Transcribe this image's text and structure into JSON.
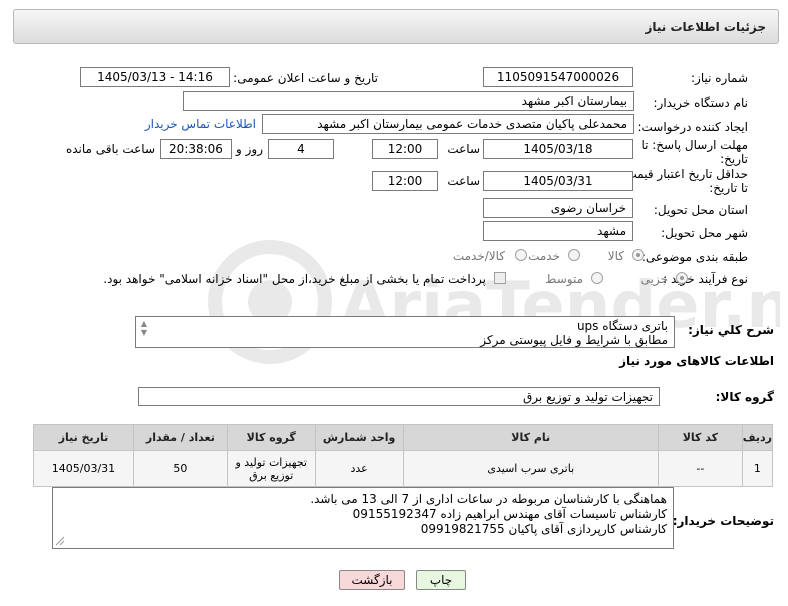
{
  "header": {
    "title": "جزئیات اطلاعات نیاز"
  },
  "fields": {
    "need_number_label": "شماره نیاز:",
    "need_number_value": "1105091547000026",
    "announce_label": "تاریخ و ساعت اعلان عمومی:",
    "announce_value": "1405/03/13 - 14:16",
    "buyer_org_label": "نام دستگاه خریدار:",
    "buyer_org_value": "بیمارستان اکبر مشهد",
    "requester_label": "ایجاد کننده درخواست:",
    "requester_value": "محمدعلی پاکیان متصدی خدمات عمومی بیمارستان اکبر مشهد",
    "contact_link": "اطلاعات تماس خریدار",
    "deadline_label_1": "مهلت ارسال پاسخ: تا",
    "deadline_label_2": "تاریخ:",
    "deadline_date": "1405/03/18",
    "time_label": "ساعت",
    "deadline_time": "12:00",
    "days_value": "4",
    "days_label": "روز و",
    "remaining_value": "20:38:06",
    "remaining_label": "ساعت باقی مانده",
    "price_valid_label_1": "حداقل تاریخ اعتبار قیمت:",
    "price_valid_label_2": "تا تاریخ:",
    "price_valid_date": "1405/03/31",
    "price_valid_time": "12:00",
    "province_label": "استان محل تحویل:",
    "province_value": "خراسان رضوی",
    "city_label": "شهر محل تحویل:",
    "city_value": "مشهد",
    "category_label": "طبقه بندی موضوعی:",
    "category_options": [
      "کالا",
      "خدمت",
      "کالا/خدمت"
    ],
    "process_label": "نوع فرآیند خرید :",
    "process_options": [
      "جزیی",
      "متوسط"
    ],
    "payment_note": "پرداخت تمام یا بخشی از مبلغ خرید،از محل \"اسناد خزانه اسلامی\" خواهد بود."
  },
  "description": {
    "label": "شرح کلي نياز:",
    "line1": "باتری دستگاه ups",
    "line2": "مطابق با شرایط و فایل پیوستی مرکز"
  },
  "goods_info": {
    "heading": "اطلاعات کالاهای مورد نیاز",
    "group_label": "گروه کالا:",
    "group_value": "تجهیزات تولید و توزیع برق"
  },
  "table": {
    "headers": [
      "ردیف",
      "کد کالا",
      "نام کالا",
      "واحد شمارش",
      "گروه کالا",
      "تعداد / مقدار",
      "تاریخ نیاز"
    ],
    "rows": [
      [
        "1",
        "--",
        "باتری سرب اسیدی",
        "عدد",
        "تجهیزات تولید و توزیع برق",
        "50",
        "1405/03/31"
      ]
    ]
  },
  "buyer_notes": {
    "label": "توضیحات خریدار:",
    "line1": "هماهنگی با کارشناسان مربوطه در ساعات اداری از 7  الی 13 می باشد.",
    "line2": "کارشناس تاسیسات آقای مهندس ابراهیم زاده 09155192347",
    "line3": "کارشناس کارپردازی آقای پاکیان 09919821755"
  },
  "buttons": {
    "print": "چاپ",
    "back": "بازگشت"
  },
  "watermark": {
    "text": "AriaTender.neT"
  },
  "colors": {
    "link": "#1a56b8",
    "back_button": "#f8d8d8",
    "print_button": "#e8f8e0"
  }
}
